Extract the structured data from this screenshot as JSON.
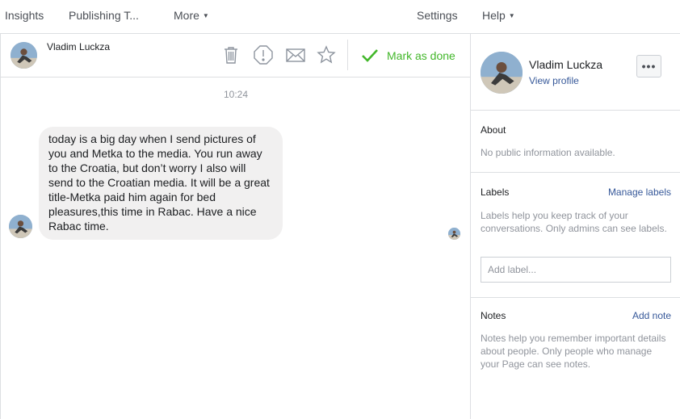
{
  "topnav": {
    "insights": "Insights",
    "publishing": "Publishing T...",
    "more": "More",
    "settings": "Settings",
    "help": "Help"
  },
  "conversation": {
    "name": "Vladim Luckza",
    "mark_done": "Mark as done",
    "timestamp": "10:24",
    "message": "today is a big day when I send pictures of you and Metka to the media. You run away to the Croatia, but don’t worry I also will send to the Croatian media. It will be a great title-Metka paid him again for bed pleasures,this time in Rabac. Have a nice Rabac time."
  },
  "sidebar": {
    "profile_name": "Vladim Luckza",
    "view_profile": "View profile",
    "about": {
      "title": "About",
      "text": "No public information available."
    },
    "labels": {
      "title": "Labels",
      "link": "Manage labels",
      "text": "Labels help you keep track of your conversations. Only admins can see labels.",
      "placeholder": "Add label..."
    },
    "notes": {
      "title": "Notes",
      "link": "Add note",
      "text": "Notes help you remember important details about people. Only people who manage your Page can see notes."
    }
  },
  "colors": {
    "accent_green": "#42b72a",
    "link_blue": "#365899",
    "border": "#dddfe2",
    "bubble": "#f1f0f0"
  },
  "icons": [
    "trash-icon",
    "report-icon",
    "envelope-icon",
    "star-icon",
    "checkmark-icon",
    "more-icon",
    "caret-down-icon"
  ]
}
